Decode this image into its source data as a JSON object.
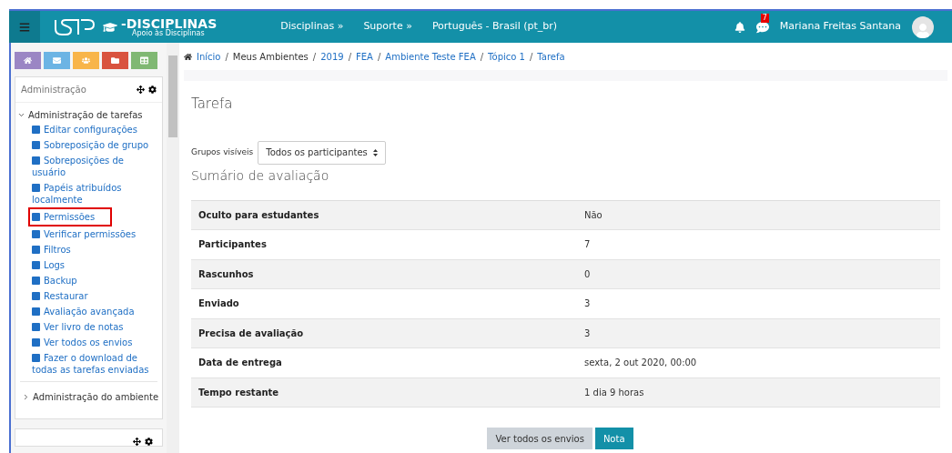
{
  "navbar": {
    "logo_title": "-DISCIPLINAS",
    "logo_subtitle": "Apoio às Disciplinas",
    "menu": [
      "Disciplinas »",
      "Suporte »",
      "Português - Brasil (pt_br)"
    ],
    "message_count": "7",
    "user_name": "Mariana Freitas Santana"
  },
  "quick_links": [
    {
      "kind": "home",
      "color": "#9b86c4"
    },
    {
      "kind": "mail",
      "color": "#6cb4e4"
    },
    {
      "kind": "users",
      "color": "#f8b54a"
    },
    {
      "kind": "folder",
      "color": "#d9533f"
    },
    {
      "kind": "calendar",
      "color": "#80b873"
    }
  ],
  "admin_block": {
    "title": "Administração",
    "sections": [
      {
        "label": "Administração de tarefas",
        "expanded": true,
        "children": [
          {
            "label": "Editar configurações",
            "highlighted": false
          },
          {
            "label": "Sobreposição de grupo",
            "highlighted": false
          },
          {
            "label": "Sobreposições de usuário",
            "highlighted": false
          },
          {
            "label": "Papéis atribuídos localmente",
            "highlighted": false
          },
          {
            "label": "Permissões",
            "highlighted": true
          },
          {
            "label": "Verificar permissões",
            "highlighted": false
          },
          {
            "label": "Filtros",
            "highlighted": false
          },
          {
            "label": "Logs",
            "highlighted": false
          },
          {
            "label": "Backup",
            "highlighted": false
          },
          {
            "label": "Restaurar",
            "highlighted": false
          },
          {
            "label": "Avaliação avançada",
            "highlighted": false
          },
          {
            "label": "Ver livro de notas",
            "highlighted": false
          },
          {
            "label": "Ver todos os envios",
            "highlighted": false
          },
          {
            "label": "Fazer o download de todas as tarefas enviadas",
            "highlighted": false
          }
        ]
      },
      {
        "label": "Administração do ambiente",
        "expanded": false
      }
    ]
  },
  "breadcrumb": [
    {
      "label": "Início",
      "link": true
    },
    {
      "label": "Meus Ambientes",
      "link": false
    },
    {
      "label": "2019",
      "link": true
    },
    {
      "label": "FEA",
      "link": true
    },
    {
      "label": "Ambiente Teste FEA",
      "link": true
    },
    {
      "label": "Tópico 1",
      "link": true
    },
    {
      "label": "Tarefa",
      "link": true
    }
  ],
  "breadcrumb_separator": "/",
  "page_title": "Tarefa",
  "group_filter": {
    "label": "Grupos visíveis",
    "value": "Todos os participantes"
  },
  "summary": {
    "title": "Sumário de avaliação",
    "rows": [
      {
        "label": "Oculto para estudantes",
        "value": "Não"
      },
      {
        "label": "Participantes",
        "value": "7"
      },
      {
        "label": "Rascunhos",
        "value": "0"
      },
      {
        "label": "Enviado",
        "value": "3"
      },
      {
        "label": "Precisa de avaliação",
        "value": "3"
      },
      {
        "label": "Data de entrega",
        "value": "sexta, 2 out 2020, 00:00"
      },
      {
        "label": "Tempo restante",
        "value": "1 dia 9 horas"
      }
    ]
  },
  "buttons": [
    {
      "label": "Ver todos os envios",
      "kind": "secondary"
    },
    {
      "label": "Nota",
      "kind": "primary"
    }
  ]
}
